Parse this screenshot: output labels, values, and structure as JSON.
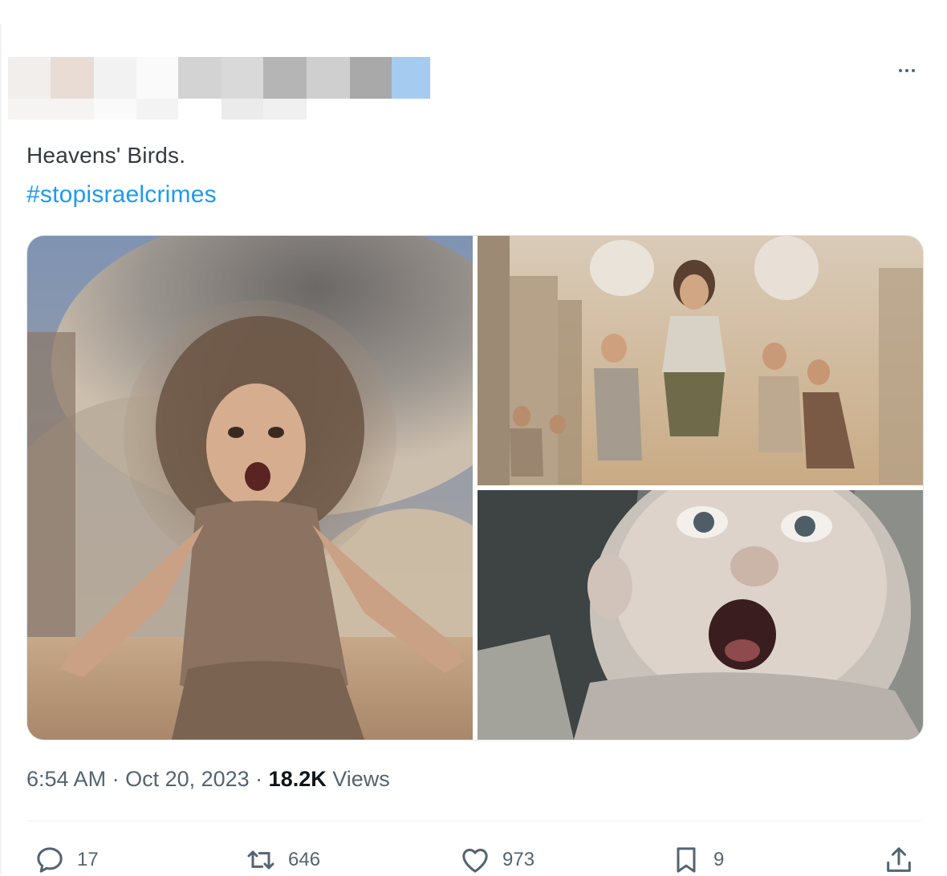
{
  "more_icon": "ellipsis-icon",
  "tweet": {
    "text": "Heavens' Birds.",
    "hashtag": "#stopisraelcrimes",
    "time": "6:54 AM",
    "date": "Oct 20, 2023",
    "views_count": "18.2K",
    "views_label": "Views"
  },
  "actions": {
    "reply": {
      "icon": "reply-icon",
      "count": "17"
    },
    "retweet": {
      "icon": "retweet-icon",
      "count": "646"
    },
    "like": {
      "icon": "heart-icon",
      "count": "973"
    },
    "bookmark": {
      "icon": "bookmark-icon",
      "count": "9"
    },
    "share": {
      "icon": "share-icon"
    }
  },
  "colors": {
    "link": "#1d9bf0",
    "secondary_text": "#536471",
    "primary_text": "#0f1419"
  }
}
